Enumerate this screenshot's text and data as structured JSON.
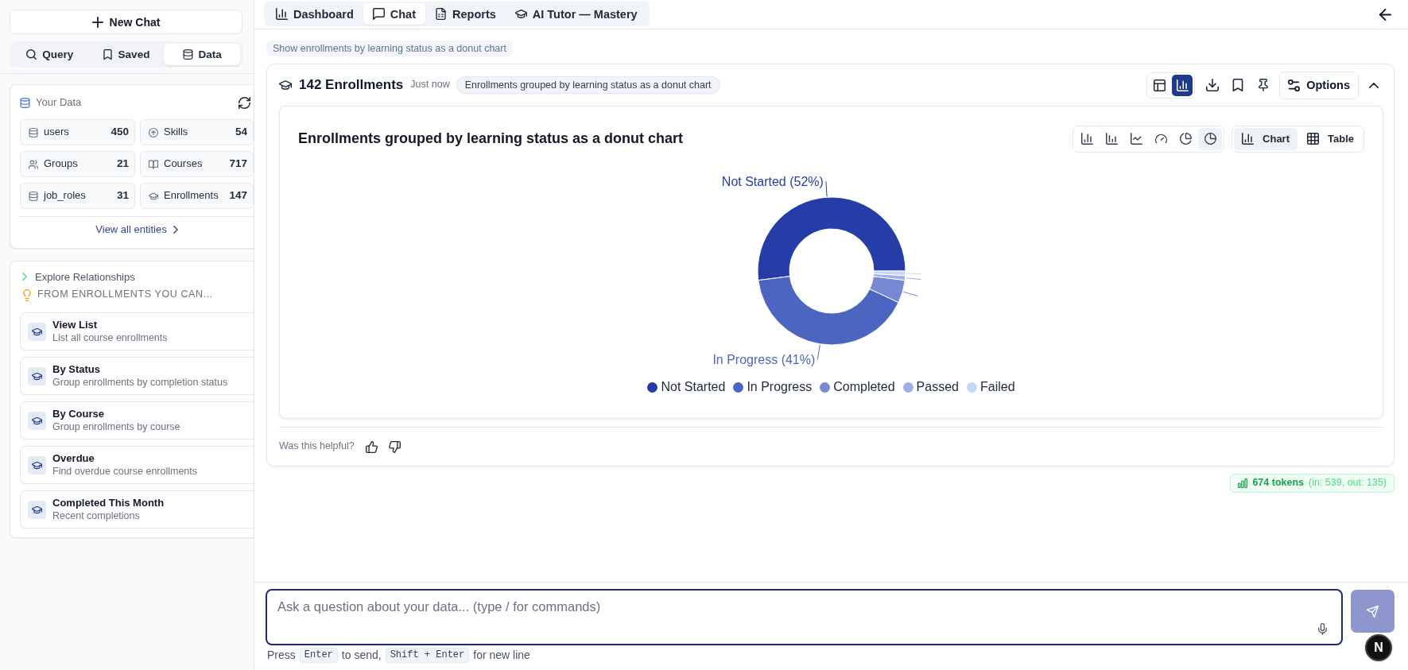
{
  "sidebar": {
    "new_chat_button": "New Chat",
    "tabs": [
      {
        "label": "Query",
        "selected": false
      },
      {
        "label": "Saved",
        "selected": false
      },
      {
        "label": "Data",
        "selected": true
      }
    ],
    "your_data": {
      "title": "Your Data",
      "entities": [
        {
          "kind": "table",
          "name": "users",
          "count": "450"
        },
        {
          "kind": "skill",
          "name": "Skills",
          "count": "54"
        },
        {
          "kind": "group",
          "name": "Groups",
          "count": "21"
        },
        {
          "kind": "course",
          "name": "Courses",
          "count": "717"
        },
        {
          "kind": "table",
          "name": "job_roles",
          "count": "31"
        },
        {
          "kind": "enrollment",
          "name": "Enrollments",
          "count": "147"
        }
      ],
      "view_all_link": "View all entities"
    },
    "explore": {
      "toggle": {
        "label": "Explore Relationships",
        "expanded": false
      },
      "heading": "FROM ENROLLMENTS YOU CAN...",
      "actions": [
        {
          "title": "View List",
          "description": "List all course enrollments"
        },
        {
          "title": "By Status",
          "description": "Group enrollments by completion status"
        },
        {
          "title": "By Course",
          "description": "Group enrollments by course"
        },
        {
          "title": "Overdue",
          "description": "Find overdue course enrollments"
        },
        {
          "title": "Completed This Month",
          "description": "Recent completions"
        }
      ]
    }
  },
  "top_tabs": [
    {
      "label": "Dashboard",
      "selected": false
    },
    {
      "label": "Chat",
      "selected": true
    },
    {
      "label": "Reports",
      "selected": false
    },
    {
      "label": "AI Tutor — Mastery",
      "selected": false
    }
  ],
  "chat": {
    "query": "Show enrollments by learning status as a donut chart",
    "result": {
      "title": "142 Enrollments",
      "time": "Just now",
      "summary": "Enrollments grouped by learning status as a donut chart",
      "views": [
        {
          "selected": false
        },
        {
          "selected": true
        }
      ],
      "options_button": "Options",
      "expanded": true,
      "chart_panel": {
        "chart_types": [
          {
            "selected": false
          },
          {
            "selected": false
          },
          {
            "selected": false
          },
          {
            "selected": false
          },
          {
            "selected": false
          },
          {
            "selected": true
          }
        ],
        "display_modes": [
          {
            "label": "Chart",
            "selected": true
          },
          {
            "label": "Table",
            "selected": false
          }
        ],
        "chart_data": {
          "type": "donut",
          "title": "Enrollments grouped by learning status as a donut chart",
          "categories": [
            "Not Started",
            "In Progress",
            "Completed",
            "Passed",
            "Failed"
          ],
          "values": [
            52,
            41,
            5,
            1,
            1
          ],
          "colors": [
            "#263da8",
            "#4c65c1",
            "#7789d4",
            "#a1b1e8",
            "#c9d7f6"
          ],
          "value_labels": [
            "Not Started (52%)",
            "In Progress (41%)",
            null,
            null,
            null
          ],
          "legend": "bottom"
        }
      },
      "feedback_prompt": "Was this helpful?"
    },
    "token_usage": {
      "total": "674 tokens",
      "detail": "(in: 539, out: 135)"
    }
  },
  "composer": {
    "placeholder": "Ask a question about your data... (type / for commands)",
    "hint": [
      {
        "kind": "text",
        "text": "Press"
      },
      {
        "kind": "key",
        "text": "Enter"
      },
      {
        "kind": "text",
        "text": "to send,"
      },
      {
        "kind": "key",
        "text": "Shift + Enter"
      },
      {
        "kind": "text",
        "text": "for new line"
      }
    ],
    "floating_badge": "N"
  }
}
